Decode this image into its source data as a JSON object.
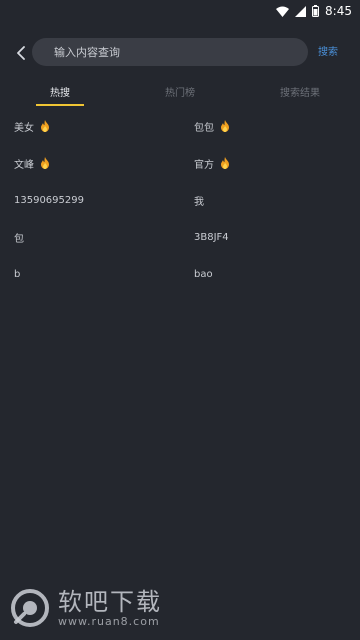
{
  "status": {
    "time": "8:45",
    "icons": [
      "wifi-icon",
      "signal-icon",
      "battery-icon"
    ]
  },
  "header": {
    "back_icon": "chevron-left-icon",
    "search_placeholder": "输入内容查询",
    "search_button": "搜索"
  },
  "tabs": [
    {
      "label": "热搜",
      "active": true
    },
    {
      "label": "热门榜",
      "active": false
    },
    {
      "label": "搜索结果",
      "active": false
    }
  ],
  "hot_items": [
    {
      "text": "美女",
      "hot": true
    },
    {
      "text": "包包",
      "hot": true
    },
    {
      "text": "文峰",
      "hot": true
    },
    {
      "text": "官方",
      "hot": true
    },
    {
      "text": "13590695299",
      "hot": false
    },
    {
      "text": "我",
      "hot": false
    },
    {
      "text": "包",
      "hot": false
    },
    {
      "text": "3B8JF4",
      "hot": false
    },
    {
      "text": "b",
      "hot": false
    },
    {
      "text": "bao",
      "hot": false
    }
  ],
  "watermark": {
    "title": "软吧下载",
    "url": "www.ruan8.com"
  },
  "colors": {
    "background": "#24272e",
    "accent": "#f0c534",
    "search_button": "#4a90d9",
    "fire": "#f0a020"
  }
}
